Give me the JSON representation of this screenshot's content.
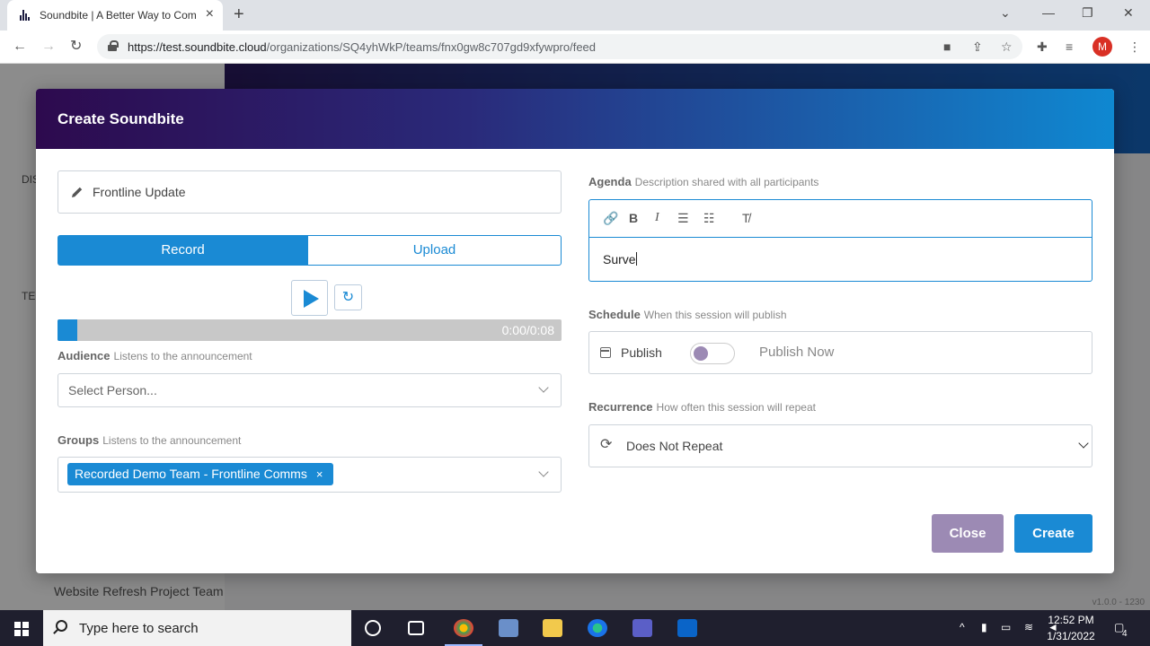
{
  "browser": {
    "tab_title": "Soundbite | A Better Way to Com",
    "url_host": "https://test.soundbite.cloud",
    "url_path": "/organizations/SQ4yhWkP/teams/fnx0gw8c707gd9xfywpro/feed",
    "profile_initial": "M"
  },
  "background": {
    "sidebar_labels": [
      "DIS",
      "TE"
    ],
    "team_name": "Website Refresh Project Team",
    "version": "v1.0.0 - 1230"
  },
  "modal": {
    "title": "Create Soundbite",
    "soundbite_title": "Frontline Update",
    "tabs": {
      "record": "Record",
      "upload": "Upload"
    },
    "recording": {
      "time": "0:00/0:08",
      "progress": 0.04
    },
    "audience": {
      "label": "Audience",
      "hint": "Listens to the announcement",
      "placeholder": "Select Person..."
    },
    "groups": {
      "label": "Groups",
      "hint": "Listens to the announcement",
      "selected": "Recorded Demo Team - Frontline Comms",
      "remove_glyph": "×"
    },
    "agenda": {
      "label": "Agenda",
      "hint": "Description shared with all participants",
      "text": "Surve"
    },
    "schedule": {
      "label": "Schedule",
      "hint": "When this session will publish",
      "field_label": "Publish",
      "toggle_text": "Publish Now",
      "toggle_on": false
    },
    "recurrence": {
      "label": "Recurrence",
      "hint": "How often this session will repeat",
      "value": "Does Not Repeat"
    },
    "buttons": {
      "close": "Close",
      "create": "Create"
    }
  },
  "taskbar": {
    "search_placeholder": "Type here to search",
    "time": "12:52 PM",
    "date": "1/31/2022",
    "notifications": "4"
  },
  "colors": {
    "accent": "#1a8ad4",
    "close_button": "#9c8ab4",
    "header_start": "#2d0a4e",
    "header_end": "#0f88d1"
  }
}
